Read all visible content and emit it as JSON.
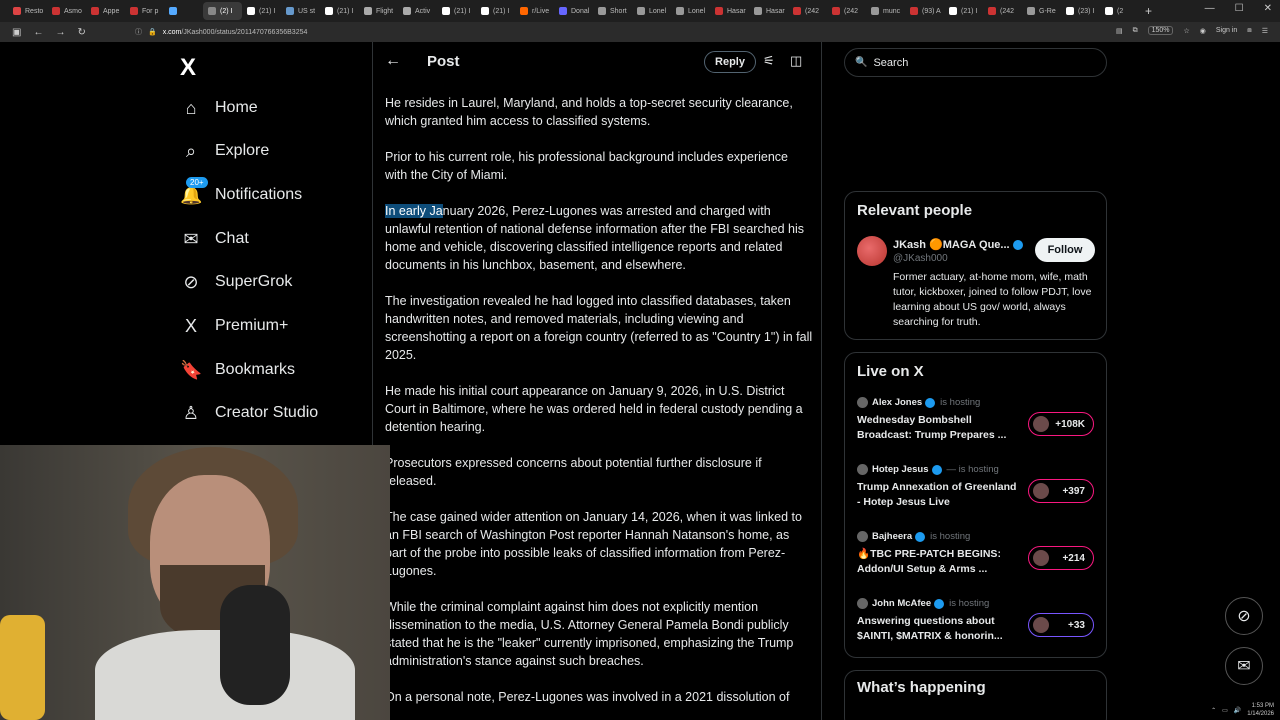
{
  "browser": {
    "tabs": [
      {
        "label": "Resto",
        "color": "#d44"
      },
      {
        "label": "Asmo",
        "color": "#c33"
      },
      {
        "label": "Appe",
        "color": "#c33"
      },
      {
        "label": "For p",
        "color": "#c33"
      },
      {
        "label": "",
        "color": "#5af"
      },
      {
        "label": "(2) I",
        "color": "#888"
      },
      {
        "label": "(21) I",
        "color": "#fff"
      },
      {
        "label": "US st",
        "color": "#69c"
      },
      {
        "label": "(21) I",
        "color": "#fff"
      },
      {
        "label": "Flight",
        "color": "#aaa"
      },
      {
        "label": "Activ",
        "color": "#aaa"
      },
      {
        "label": "(21) I",
        "color": "#fff"
      },
      {
        "label": "(21) I",
        "color": "#fff"
      },
      {
        "label": "r/Live",
        "color": "#f60"
      },
      {
        "label": "Donal",
        "color": "#66f"
      },
      {
        "label": "Short",
        "color": "#999"
      },
      {
        "label": "Lonel",
        "color": "#999"
      },
      {
        "label": "Lonel",
        "color": "#999"
      },
      {
        "label": "Hasar",
        "color": "#c33"
      },
      {
        "label": "Hasar",
        "color": "#999"
      },
      {
        "label": "(242",
        "color": "#c33"
      },
      {
        "label": "(242",
        "color": "#c33"
      },
      {
        "label": "munc",
        "color": "#999"
      },
      {
        "label": "(93) A",
        "color": "#c33"
      },
      {
        "label": "(21) I",
        "color": "#fff"
      },
      {
        "label": "(242",
        "color": "#c33"
      },
      {
        "label": "G-Re",
        "color": "#999"
      },
      {
        "label": "(23) I",
        "color": "#fff"
      },
      {
        "label": "(2",
        "color": "#fff"
      }
    ],
    "url_domain": "x.com",
    "url_path": "/JKash000/status/2011470766356B3254",
    "zoom": "150%",
    "sign_in": "Sign in"
  },
  "sidebar": {
    "logo": "X",
    "items": [
      {
        "label": "Home",
        "icon": "⌂"
      },
      {
        "label": "Explore",
        "icon": "⌕"
      },
      {
        "label": "Notifications",
        "icon": "🔔"
      },
      {
        "label": "Chat",
        "icon": "✉"
      },
      {
        "label": "SuperGrok",
        "icon": "⊘"
      },
      {
        "label": "Premium+",
        "icon": "X"
      },
      {
        "label": "Bookmarks",
        "icon": "🔖"
      },
      {
        "label": "Creator Studio",
        "icon": "♙"
      }
    ],
    "notif_badge": "20+"
  },
  "post": {
    "title": "Post",
    "reply_label": "Reply",
    "highlight": "In early Ja",
    "p3_rest": "nuary 2026, Perez-Lugones was arrested and charged with unlawful retention of national defense information after the FBI searched his home and vehicle, discovering classified intelligence reports and related documents in his lunchbox, basement, and elsewhere.",
    "paragraphs": [
      "He resides in Laurel, Maryland, and holds a top-secret security clearance, which granted him access to classified systems.",
      "Prior to his current role, his professional background includes experience with the City of Miami.",
      "The investigation revealed he had logged into classified databases, taken handwritten notes, and removed materials, including viewing and screenshotting a report on a foreign country (referred to as \"Country 1\") in fall 2025.",
      "He made his initial court appearance on January 9, 2026, in U.S. District Court in Baltimore, where he was ordered held in federal custody pending a detention hearing.",
      "Prosecutors expressed concerns about potential further disclosure if released.",
      "The case gained wider attention on January 14, 2026, when it was linked to an FBI search of Washington Post reporter Hannah Natanson's home, as part of the probe into possible leaks of classified information from Perez-Lugones.",
      "While the criminal complaint against him does not explicitly mention dissemination to the media, U.S. Attorney General Pamela Bondi publicly stated that he is the \"leaker\" currently imprisoned, emphasizing the Trump administration's stance against such breaches.",
      "On a personal note, Perez-Lugones was involved in a 2021 dissolution of"
    ]
  },
  "right": {
    "search_placeholder": "Search",
    "relevant_title": "Relevant people",
    "person": {
      "name": "JKash 🟠MAGA Que...",
      "handle": "@JKash000",
      "follow": "Follow",
      "bio": "Former actuary, at-home mom, wife, math tutor, kickboxer, joined to follow PDJT, love learning about US gov/ world, always searching for truth."
    },
    "live_title": "Live on X",
    "hosting_label": "is hosting",
    "live": [
      {
        "host": "Alex Jones",
        "title": "Wednesday Bombshell Broadcast: Trump Prepares ...",
        "count": "+108K",
        "ring": "pink"
      },
      {
        "host": "Hotep Jesus",
        "title": "Trump Annexation of Greenland - Hotep Jesus Live",
        "count": "+397",
        "ring": "pink"
      },
      {
        "host": "Bajheera",
        "title": "🔥TBC PRE-PATCH BEGINS: Addon/UI Setup & Arms ...",
        "count": "+214",
        "ring": "pink"
      },
      {
        "host": "John McAfee",
        "title": "Answering questions about $AINTI, $MATRIX & honorin...",
        "count": "+33",
        "ring": "purple"
      }
    ],
    "happening_title": "What’s happening"
  },
  "tray": {
    "time": "1:53 PM",
    "date": "1/14/2026"
  }
}
